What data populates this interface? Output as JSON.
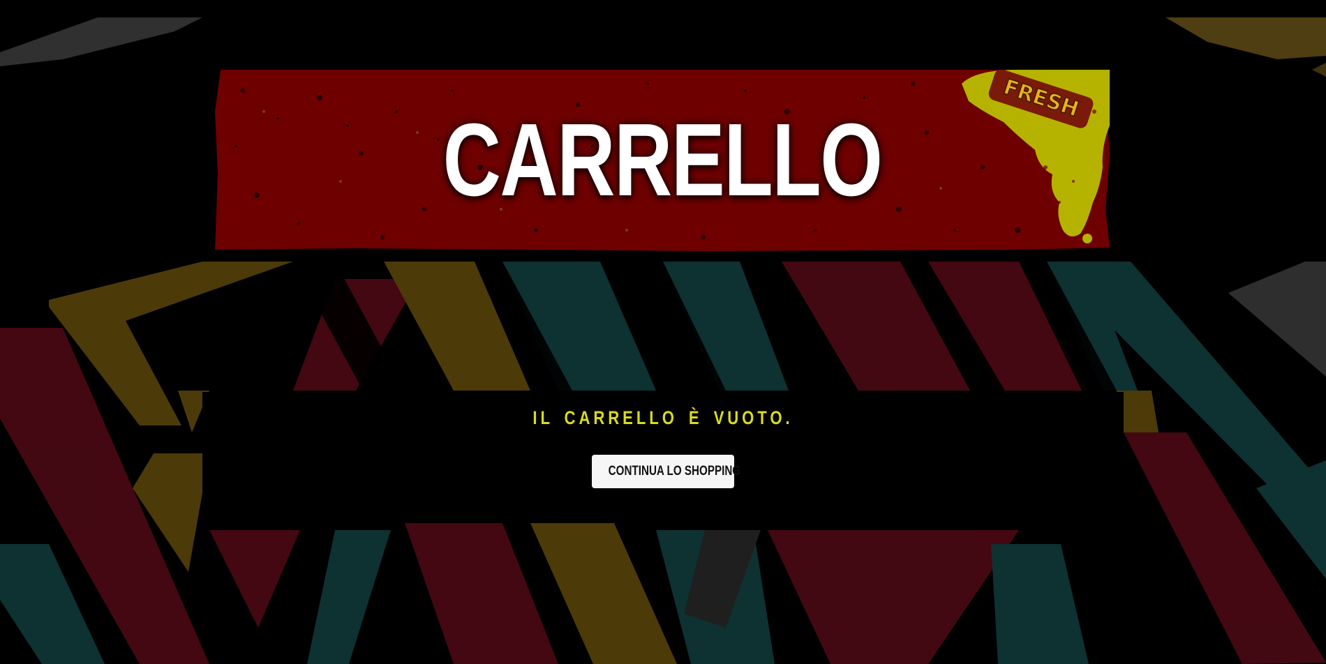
{
  "page": {
    "title": "CARRELLO"
  },
  "cart": {
    "empty_message": "IL CARRELLO È VUOTO.",
    "continue_button_label": "CONTINUA LO SHOPPING"
  },
  "colors": {
    "banner_red": "#6e0000",
    "message_yellow": "#d9dc1f",
    "button_bg": "#f6f6f6",
    "page_bg": "#000000"
  },
  "icons": {
    "graffiti_logo": "graffiti-tag-logo"
  }
}
